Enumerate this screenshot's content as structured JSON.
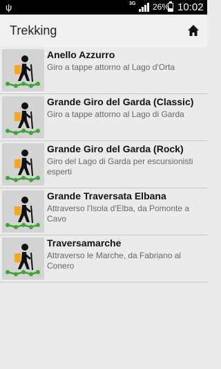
{
  "status_bar": {
    "network_type": "3G",
    "battery_percent": "26%",
    "time": "10:02"
  },
  "app_bar": {
    "title": "Trekking",
    "home_icon": "home-icon"
  },
  "routes": [
    {
      "title": "Anello Azzurro",
      "description": "Giro a tappe attorno al Lago d'Orta",
      "icon": "hiker-icon"
    },
    {
      "title": "Grande Giro del Garda (Classic)",
      "description": "Giro a tappe attorno al Lago di Garda",
      "icon": "hiker-icon"
    },
    {
      "title": "Grande Giro del Garda (Rock)",
      "description": "Giro del Lago di Garda per escursionisti esperti",
      "icon": "hiker-icon"
    },
    {
      "title": "Grande Traversata Elbana",
      "description": "Attraverso l'Isola d'Elba, da Pomonte a Cavo",
      "icon": "hiker-icon"
    },
    {
      "title": "Traversamarche",
      "description": "Attraverso le Marche, da Fabriano al Conero",
      "icon": "hiker-icon"
    }
  ],
  "colors": {
    "backpack": "#f5a623",
    "trail": "#3ca535",
    "thumbnail_bg": "#d3d3d3"
  }
}
